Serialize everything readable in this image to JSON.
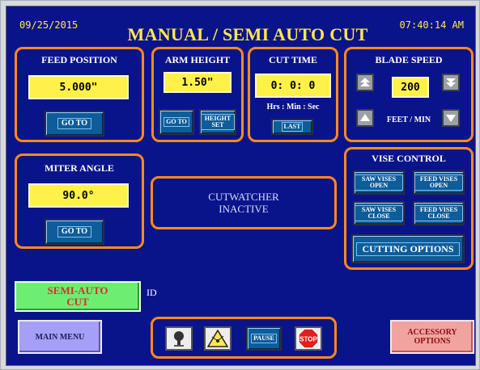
{
  "header": {
    "date": "09/25/2015",
    "title": "MANUAL / SEMI AUTO CUT",
    "time": "07:40:14 AM"
  },
  "feed_position": {
    "label": "FEED POSITION",
    "value": "5.000\"",
    "goto": "GO TO"
  },
  "arm_height": {
    "label": "ARM HEIGHT",
    "value": "1.50\"",
    "goto": "GO TO",
    "height_set": "HEIGHT SET"
  },
  "cut_time": {
    "label": "CUT TIME",
    "value": "0: 0: 0",
    "units": "Hrs : Min : Sec",
    "last": "LAST"
  },
  "blade_speed": {
    "label": "BLADE SPEED",
    "value": "200",
    "units": "FEET / MIN"
  },
  "miter_angle": {
    "label": "MITER ANGLE",
    "value": "90.0°",
    "goto": "GO TO"
  },
  "status": {
    "line1": "CUTWATCHER",
    "line2": "INACTIVE"
  },
  "vise_control": {
    "label": "VISE CONTROL",
    "saw_open": "SAW VISES OPEN",
    "feed_open": "FEED VISES OPEN",
    "saw_close": "SAW VISES CLOSE",
    "feed_close": "FEED VISES CLOSE",
    "cutting_options": "CUTTING OPTIONS"
  },
  "mode": {
    "label_line1": "SEMI-AUTO",
    "label_line2": "CUT",
    "id": "ID"
  },
  "footer": {
    "main_menu": "MAIN MENU",
    "accessory": "ACCESSORY OPTIONS",
    "pause": "PAUSE",
    "stop": "STOP"
  },
  "colors": {
    "screen": "#0a148a",
    "border": "#ff8a1c",
    "value_bg": "#fff14a",
    "button": "#0f5c9a"
  }
}
